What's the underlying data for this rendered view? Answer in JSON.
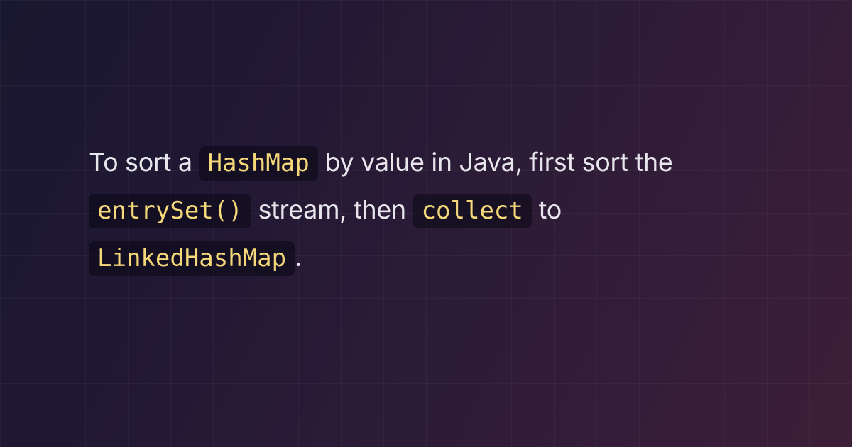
{
  "description": {
    "text_1": "To sort a ",
    "code_1": "HashMap",
    "text_2": " by value in Java, first sort the ",
    "code_2": "entrySet()",
    "text_3": " stream, then ",
    "code_3": "collect",
    "text_4": " to ",
    "code_4": "LinkedHashMap",
    "text_5": "."
  },
  "colors": {
    "bg_gradient_start": "#1a1830",
    "bg_gradient_end": "#3d1f37",
    "text": "#e8e6ed",
    "code_text": "#f5d87a",
    "code_bg": "rgba(10,8,20,0.55)",
    "grid_line": "rgba(255,255,255,0.035)"
  }
}
